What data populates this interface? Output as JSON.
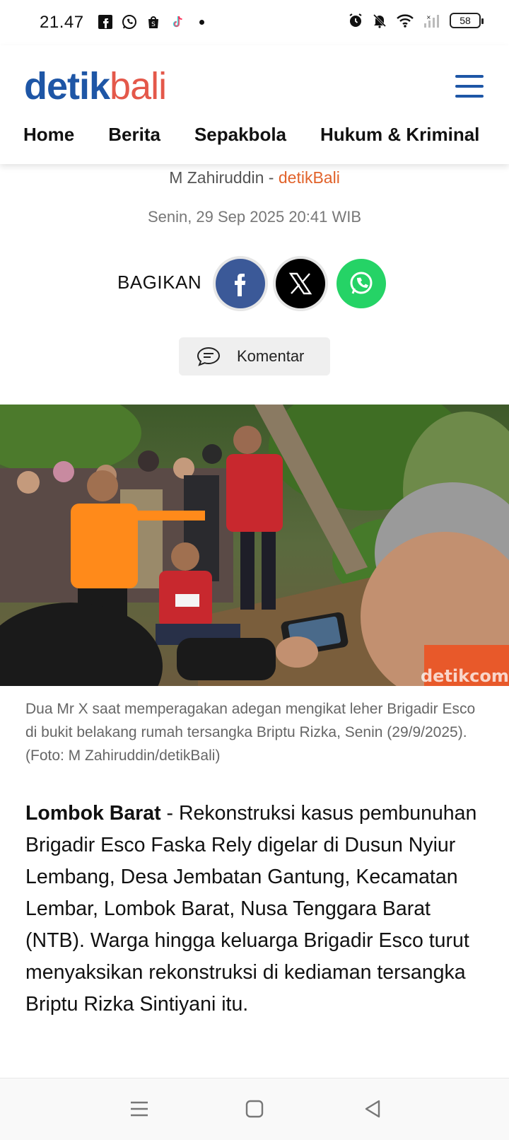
{
  "status_bar": {
    "time": "21.47",
    "battery": "58",
    "left_icons": [
      "facebook-icon",
      "whatsapp-icon",
      "shopee-icon",
      "tiktok-icon",
      "dot-icon"
    ],
    "right_icons": [
      "alarm-icon",
      "mute-icon",
      "wifi-icon",
      "signal-icon",
      "battery-icon"
    ]
  },
  "header": {
    "logo_part1": "detik",
    "logo_part2": "bali",
    "nav": [
      "Home",
      "Berita",
      "Sepakbola",
      "Hukum & Kriminal"
    ]
  },
  "meta": {
    "author": "M Zahiruddin",
    "separator": " - ",
    "source": "detikBali",
    "date": "Senin, 29 Sep 2025 20:41 WIB"
  },
  "share": {
    "label": "BAGIKAN",
    "buttons": [
      "facebook-icon",
      "x-icon",
      "whatsapp-icon"
    ]
  },
  "comment": {
    "label": "Komentar"
  },
  "photo": {
    "watermark": "detikcom"
  },
  "caption": "Dua Mr X saat memperagakan adegan mengikat leher Brigadir Esco di bukit belakang rumah tersangka Briptu Rizka, Senin (29/9/2025). (Foto: M Zahiruddin/detikBali)",
  "article": {
    "location": "Lombok Barat",
    "body": " - Rekonstruksi kasus pembunuhan Brigadir Esco Faska Rely digelar di Dusun Nyiur Lembang, Desa Jembatan Gantung, Kecamatan Lembar, Lombok Barat, Nusa Tenggara Barat (NTB). Warga hingga keluarga Brigadir Esco turut menyaksikan rekonstruksi di kediaman tersangka Briptu Rizka Sintiyani itu."
  },
  "colors": {
    "brand_blue": "#1e56a6",
    "brand_red": "#e4584a",
    "source_orange": "#e1622a",
    "facebook": "#3b5998",
    "whatsapp": "#25d366"
  }
}
